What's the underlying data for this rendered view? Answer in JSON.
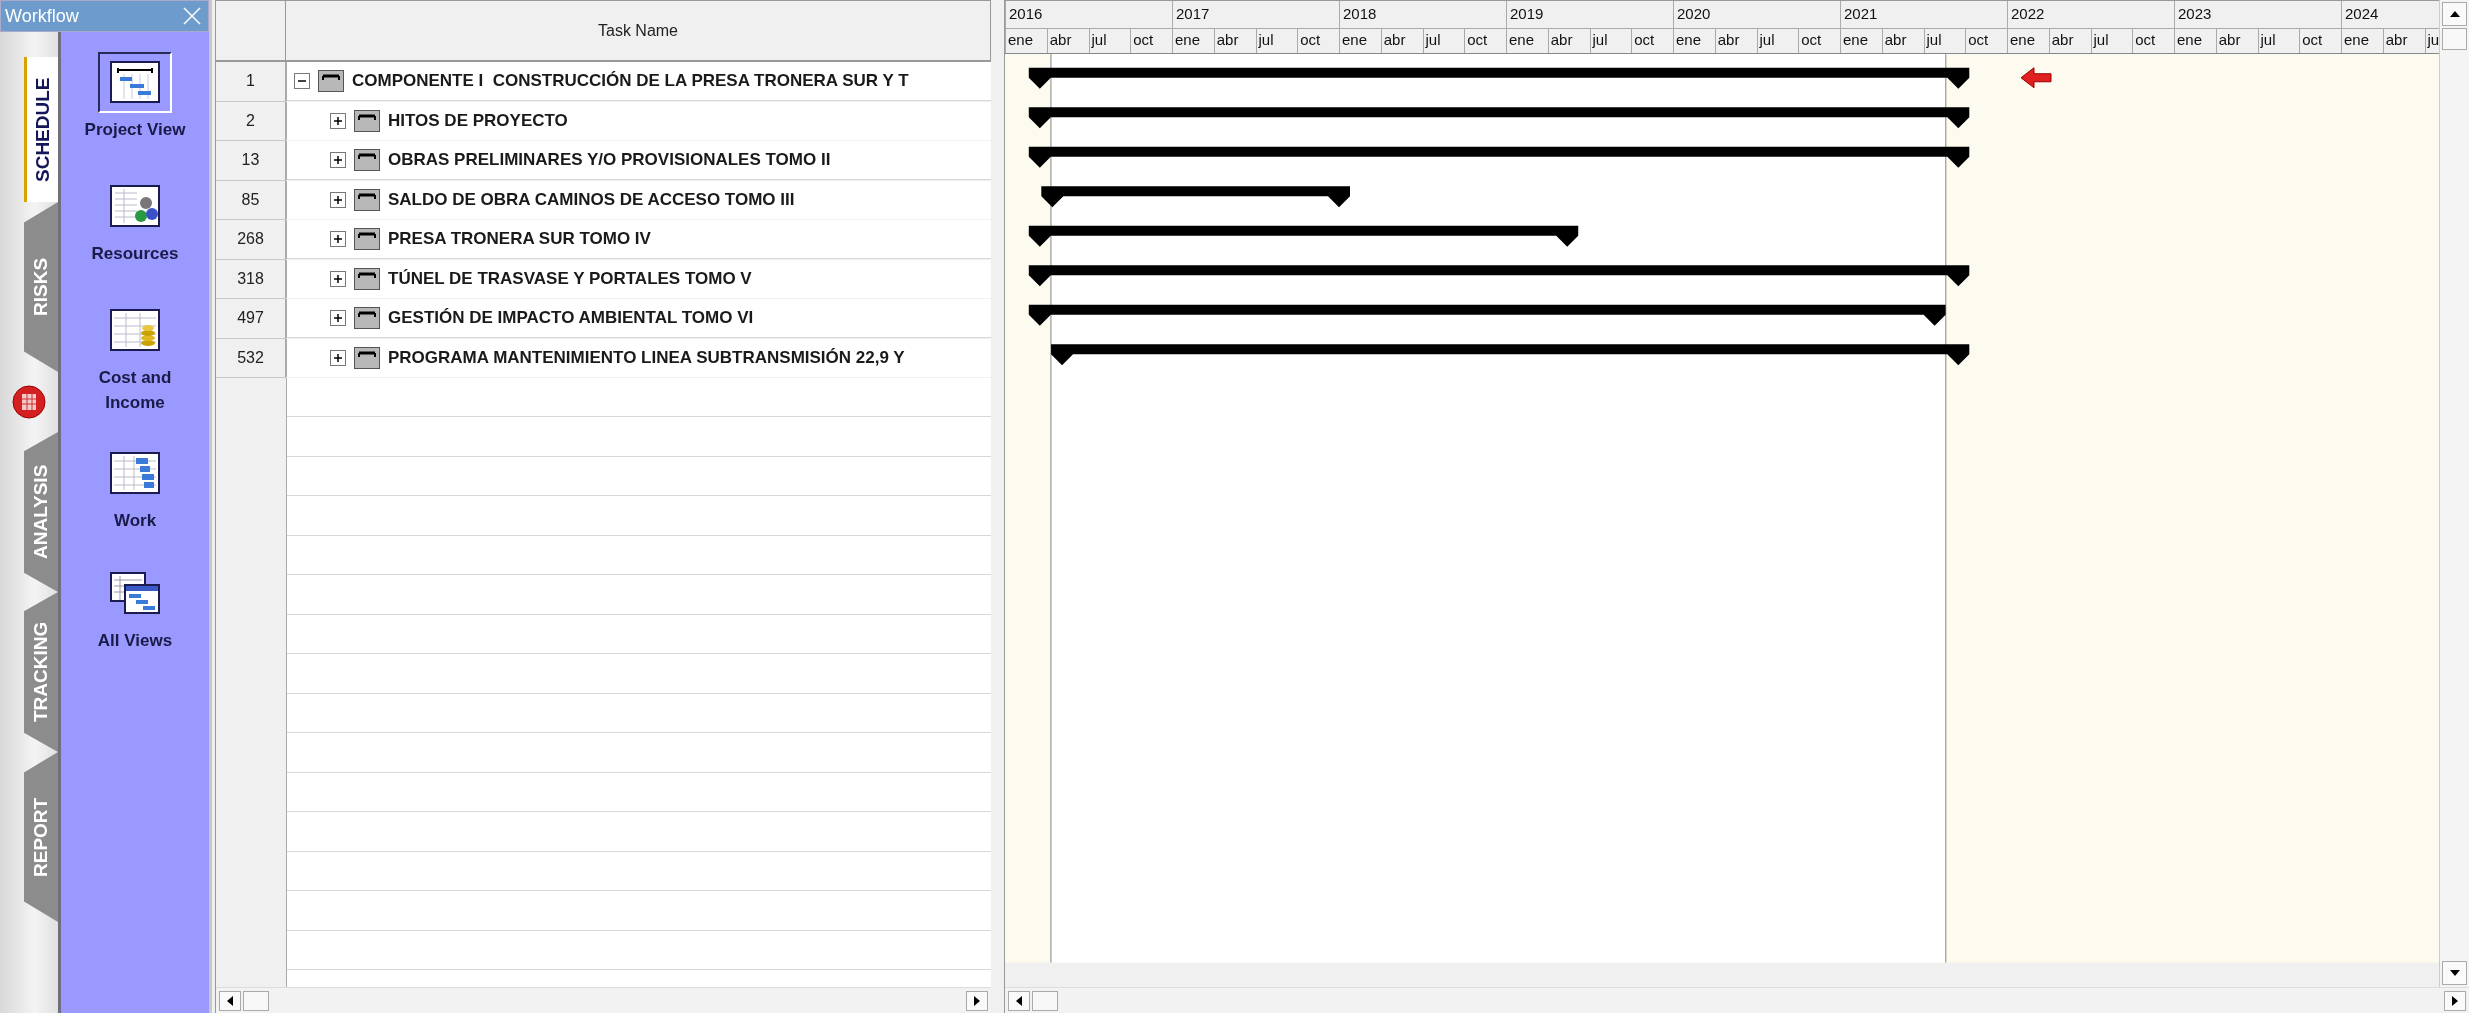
{
  "workflow": {
    "title": "Workflow",
    "tabs": [
      {
        "label": "SCHEDULE",
        "selected": true
      },
      {
        "label": "RISKS",
        "selected": false
      },
      {
        "label": "ANALYSIS",
        "selected": false
      },
      {
        "label": "TRACKING",
        "selected": false
      },
      {
        "label": "REPORT",
        "selected": false
      }
    ],
    "items": [
      {
        "label": "Project View",
        "kind": "project",
        "selected": true
      },
      {
        "label": "Resources",
        "kind": "resources",
        "selected": false
      },
      {
        "label": "Cost and Income",
        "kind": "cost",
        "selected": false
      },
      {
        "label": "Work",
        "kind": "work",
        "selected": false
      },
      {
        "label": "All Views",
        "kind": "all",
        "selected": false
      }
    ]
  },
  "grid": {
    "columns": [
      "Task Name"
    ],
    "tasks": [
      {
        "id": "1",
        "name": "COMPONENTE I  CONSTRUCCIÓN DE LA PRESA TRONERA SUR Y T",
        "expanded": true,
        "children": [
          {
            "id": "2",
            "name": "HITOS DE PROYECTO",
            "expanded": false
          },
          {
            "id": "13",
            "name": "OBRAS PRELIMINARES Y/O PROVISIONALES TOMO II",
            "expanded": false
          },
          {
            "id": "85",
            "name": "SALDO DE OBRA CAMINOS DE ACCESO TOMO III",
            "expanded": false
          },
          {
            "id": "268",
            "name": "PRESA TRONERA SUR TOMO IV",
            "expanded": false
          },
          {
            "id": "318",
            "name": "TÚNEL DE TRASVASE Y PORTALES TOMO V",
            "expanded": false
          },
          {
            "id": "497",
            "name": "GESTIÓN DE IMPACTO AMBIENTAL TOMO VI",
            "expanded": false
          },
          {
            "id": "532",
            "name": "PROGRAMA MANTENIMIENTO LINEA SUBTRANSMISIÓN 22,9 Y",
            "expanded": false
          }
        ]
      }
    ]
  },
  "timeline": {
    "years": [
      {
        "label": "2016",
        "quarters": [
          "ene",
          "abr",
          "jul",
          "oct"
        ]
      },
      {
        "label": "2017",
        "quarters": [
          "ene",
          "abr",
          "jul",
          "oct"
        ]
      },
      {
        "label": "2018",
        "quarters": [
          "ene",
          "abr",
          "jul",
          "oct"
        ]
      },
      {
        "label": "2019",
        "quarters": [
          "ene",
          "abr",
          "jul",
          "oct"
        ]
      },
      {
        "label": "2020",
        "quarters": [
          "ene",
          "abr",
          "jul",
          "oct"
        ]
      },
      {
        "label": "2021",
        "quarters": [
          "ene",
          "abr",
          "jul",
          "oct"
        ]
      },
      {
        "label": "2022",
        "quarters": [
          "ene",
          "abr",
          "jul",
          "oct"
        ]
      },
      {
        "label": "2023",
        "quarters": [
          "ene",
          "abr",
          "jul",
          "oct"
        ]
      },
      {
        "label": "2024",
        "quarters": [
          "ene",
          "abr",
          "ju"
        ]
      }
    ]
  }
}
